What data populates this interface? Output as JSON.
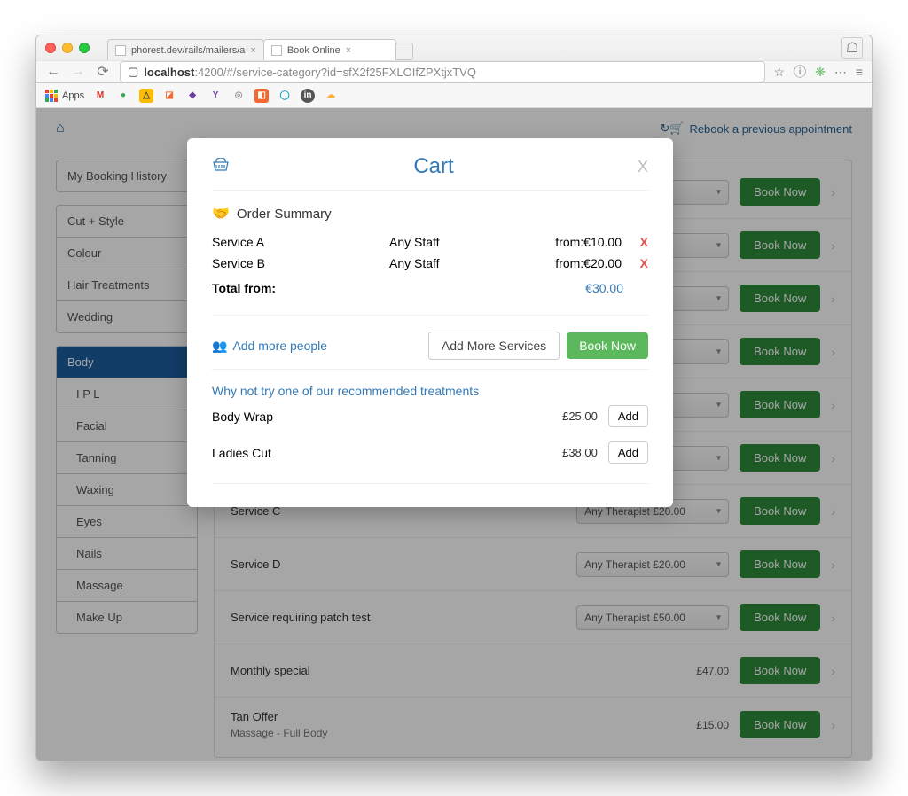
{
  "browser": {
    "tabs": [
      {
        "title": "phorest.dev/rails/mailers/a",
        "active": false
      },
      {
        "title": "Book Online",
        "active": true
      }
    ],
    "url_host": "localhost",
    "url_port": ":4200",
    "url_path": "/#/service-category?id=sfX2f25FXLOIfZPXtjxTVQ",
    "bookmarks_label": "Apps"
  },
  "page": {
    "rebook_label": "Rebook a previous appointment",
    "booking_history": "My Booking History",
    "categories_top": [
      "Cut + Style",
      "Colour",
      "Hair Treatments",
      "Wedding"
    ],
    "categories_main": [
      {
        "label": "Body",
        "active": true,
        "indent": false
      },
      {
        "label": "I P L",
        "active": false,
        "indent": true
      },
      {
        "label": "Facial",
        "active": false,
        "indent": true
      },
      {
        "label": "Tanning",
        "active": false,
        "indent": true
      },
      {
        "label": "Waxing",
        "active": false,
        "indent": true
      },
      {
        "label": "Eyes",
        "active": false,
        "indent": true
      },
      {
        "label": "Nails",
        "active": false,
        "indent": true
      },
      {
        "label": "Massage",
        "active": false,
        "indent": true
      },
      {
        "label": "Make Up",
        "active": false,
        "indent": true
      }
    ],
    "therapist_default": "Any Therapist",
    "book_label": "Book Now",
    "services": [
      {
        "name": "",
        "price": "",
        "select": true
      },
      {
        "name": "",
        "price": "",
        "select": true
      },
      {
        "name": "",
        "price": "",
        "select": true
      },
      {
        "name": "",
        "price": "",
        "select": true
      },
      {
        "name": "",
        "price": "",
        "select": true
      },
      {
        "name": "",
        "price": "",
        "select": true
      },
      {
        "name": "Service C",
        "price": "£20.00",
        "select": true
      },
      {
        "name": "Service D",
        "price": "£20.00",
        "select": true
      },
      {
        "name": "Service requiring patch test",
        "price": "£50.00",
        "select": true
      },
      {
        "name": "Monthly special",
        "price": "£47.00",
        "select": false
      },
      {
        "name": "Tan Offer",
        "sub": "Massage - Full Body",
        "price": "£15.00",
        "select": false
      }
    ]
  },
  "cart": {
    "title": "Cart",
    "summary_label": "Order Summary",
    "items": [
      {
        "service": "Service A",
        "staff": "Any Staff",
        "price": "from:€10.00"
      },
      {
        "service": "Service B",
        "staff": "Any Staff",
        "price": "from:€20.00"
      }
    ],
    "remove_label": "X",
    "total_label": "Total from:",
    "total_value": "€30.00",
    "add_people": "Add more people",
    "add_services": "Add More Services",
    "book_now": "Book Now",
    "reco_heading": "Why not try one of our recommended treatments",
    "reco": [
      {
        "name": "Body Wrap",
        "price": "£25.00",
        "btn": "Add"
      },
      {
        "name": "Ladies Cut",
        "price": "£38.00",
        "btn": "Add"
      }
    ]
  }
}
